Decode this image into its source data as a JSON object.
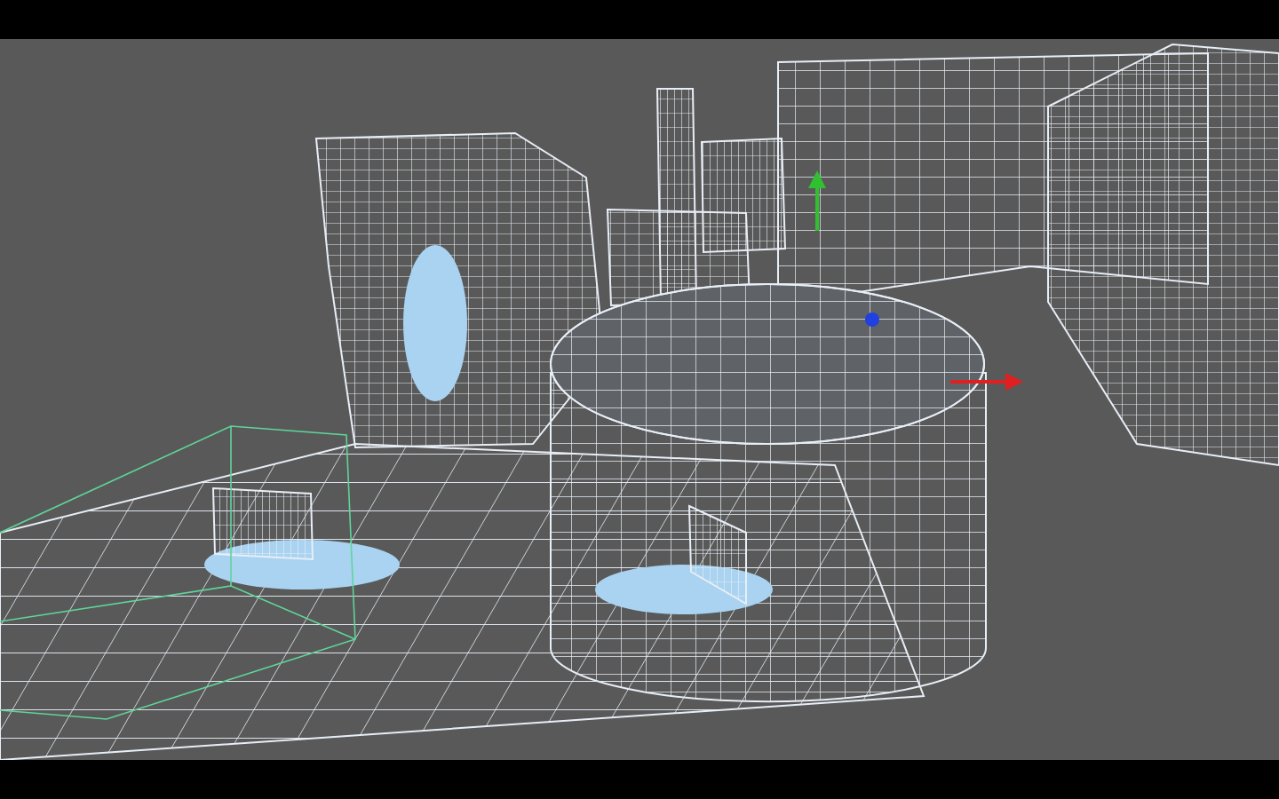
{
  "viewport": {
    "letterboxed": true
  }
}
